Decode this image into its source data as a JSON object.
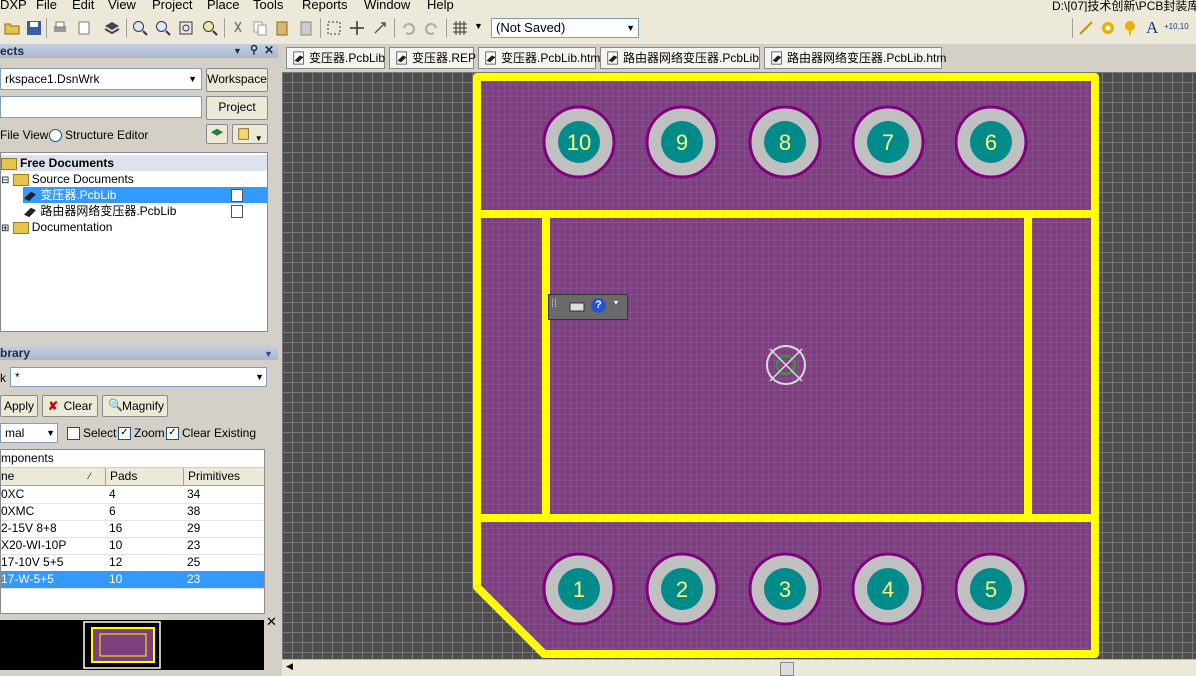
{
  "menu": {
    "items": [
      "DXP",
      "File",
      "Edit",
      "View",
      "Project",
      "Place",
      "Tools",
      "Reports",
      "Window",
      "Help"
    ],
    "path": "D:\\[07]技术创新\\PCB封装库"
  },
  "toolbar": {
    "saved_state": "(Not Saved)"
  },
  "projects_panel": {
    "title": "ects",
    "workspace_value": "rkspace1.DsnWrk",
    "workspace_button": "Workspace",
    "project_button": "Project",
    "view_file": "File View",
    "view_structure": "Structure Editor",
    "tree": {
      "root": "Free Documents",
      "source_folder": "Source Documents",
      "doc1": "变压器.PcbLib",
      "doc2": "路由器网络变压器.PcbLib",
      "documentation": "Documentation"
    }
  },
  "library_panel": {
    "title": "brary",
    "mask_label": "k",
    "mask_value": "*",
    "apply": "Apply",
    "clear": "Clear",
    "magnify": "Magnify",
    "mode": "mal",
    "select": "Select",
    "zoom": "Zoom",
    "clear_existing": "Clear Existing",
    "components_title": "mponents",
    "columns": {
      "name": "ne",
      "pads": "Pads",
      "prims": "Primitives"
    },
    "rows": [
      {
        "name": "0XC",
        "pads": "4",
        "prims": "34"
      },
      {
        "name": "0XMC",
        "pads": "6",
        "prims": "38"
      },
      {
        "name": "2-15V 8+8",
        "pads": "16",
        "prims": "29"
      },
      {
        "name": "X20-WI-10P",
        "pads": "10",
        "prims": "23"
      },
      {
        "name": "17-10V 5+5",
        "pads": "12",
        "prims": "25"
      },
      {
        "name": "17-W-5+5",
        "pads": "10",
        "prims": "23"
      }
    ],
    "selected_row": 5
  },
  "tabs": [
    "变压器.PcbLib",
    "变压器.REP",
    "变压器.PcbLib.htm",
    "路由器网络变压器.PcbLib",
    "路由器网络变压器.PcbLib.htm"
  ],
  "pcb": {
    "pads_top": [
      "10",
      "9",
      "8",
      "7",
      "6"
    ],
    "pads_bottom": [
      "1",
      "2",
      "3",
      "4",
      "5"
    ],
    "colors": {
      "outline": "#ffff00",
      "body": "#7d3f7f",
      "pad_ring": "#c0c0c0",
      "pad_core": "#008b8b",
      "pad_edge": "#800080",
      "canvas": "#4d4d4d"
    }
  }
}
